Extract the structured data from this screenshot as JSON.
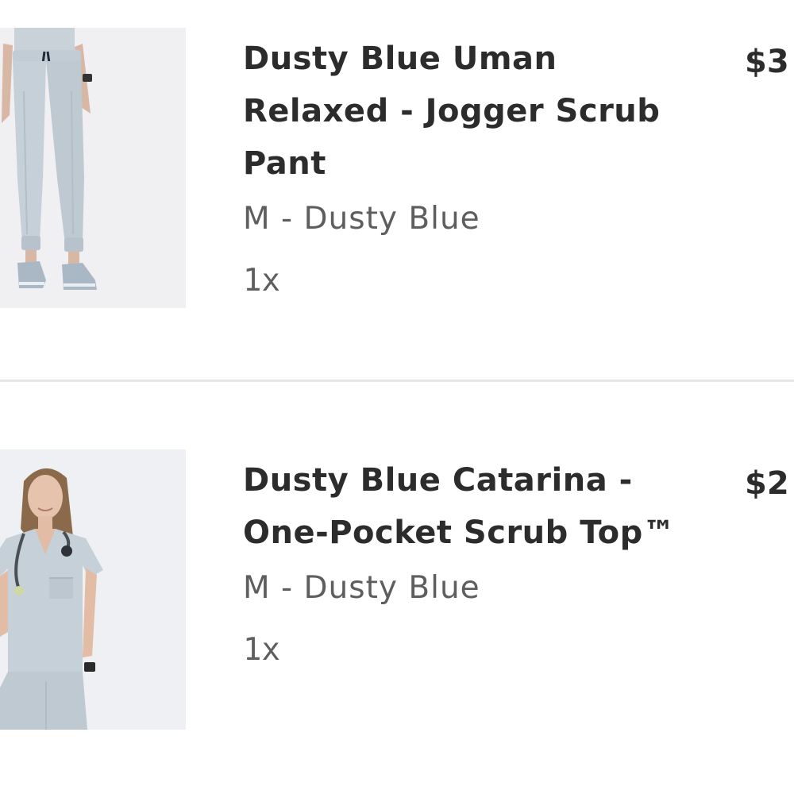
{
  "cart": {
    "items": [
      {
        "title": "Dusty Blue Uman Relaxed - Jogger Scrub Pant",
        "variant": "M - Dusty Blue",
        "quantity": "1x",
        "price": "$3",
        "image_icon": "jogger-pant-product-photo"
      },
      {
        "title": "Dusty Blue Catarina - One-Pocket Scrub Top™",
        "variant": "M - Dusty Blue",
        "quantity": "1x",
        "price": "$2",
        "image_icon": "scrub-top-product-photo"
      }
    ]
  },
  "colors": {
    "background": "#ffffff",
    "title_text": "#2c2c2c",
    "secondary_text": "#5e5e5e",
    "divider": "#e6e6e6",
    "scrub_dusty_blue": "#c6d0d8"
  }
}
